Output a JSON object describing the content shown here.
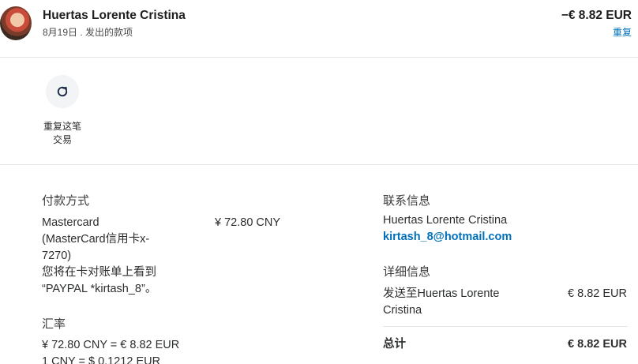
{
  "header": {
    "name": "Huertas Lorente Cristina",
    "subtitle": "8月19日 . 发出的款项",
    "amount": "−€ 8.82 EUR",
    "repeat_link": "重复"
  },
  "repeat_action": {
    "icon": "refresh-icon",
    "label_line1": "重复这笔",
    "label_line2": "交易"
  },
  "payment": {
    "title": "付款方式",
    "method_line1": "Mastercard",
    "method_line2": "(MasterCard信用卡x-",
    "method_line3": "7270)",
    "note_line1": "您将在卡对账单上看到",
    "note_line2": "“PAYPAL *kirtash_8”。",
    "amount": "¥ 72.80 CNY"
  },
  "exchange": {
    "title": "汇率",
    "line1": "¥ 72.80 CNY = € 8.82 EUR",
    "line2": "1 CNY = $ 0.1212 EUR"
  },
  "contact": {
    "title": "联系信息",
    "name": "Huertas Lorente Cristina",
    "email": "kirtash_8@hotmail.com"
  },
  "details": {
    "title": "详细信息",
    "sent_to_line1": "发送至Huertas Lorente",
    "sent_to_line2": "Cristina",
    "sent_amount": "€ 8.82 EUR",
    "total_label": "总计",
    "total_amount": "€ 8.82 EUR"
  },
  "colors": {
    "accent": "#0070ba",
    "divider": "#e6e6e6",
    "icon_bg": "#f2f4f5"
  }
}
